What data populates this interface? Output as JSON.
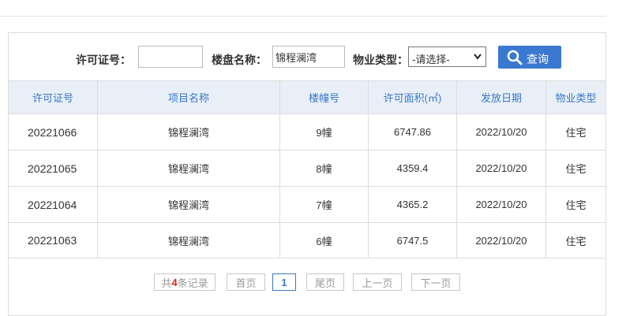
{
  "search": {
    "permit_label": "许可证号：",
    "permit_value": "",
    "project_label": "楼盘名称：",
    "project_value": "锦程澜湾",
    "type_label": "物业类型：",
    "type_selected": "-请选择-",
    "search_button": "查询"
  },
  "table": {
    "headers": [
      "许可证号",
      "项目名称",
      "楼幢号",
      "许可面积(㎡)",
      "发放日期",
      "物业类型"
    ],
    "rows": [
      [
        "20221066",
        "锦程澜湾",
        "9幢",
        "6747.86",
        "2022/10/20",
        "住宅"
      ],
      [
        "20221065",
        "锦程澜湾",
        "8幢",
        "4359.4",
        "2022/10/20",
        "住宅"
      ],
      [
        "20221064",
        "锦程澜湾",
        "7幢",
        "4365.2",
        "2022/10/20",
        "住宅"
      ],
      [
        "20221063",
        "锦程澜湾",
        "6幢",
        "6747.5",
        "2022/10/20",
        "住宅"
      ]
    ]
  },
  "pager": {
    "total_prefix": "共",
    "total_count": "4",
    "total_suffix": "条记录",
    "first": "首页",
    "current": "1",
    "last": "尾页",
    "prev": "上一页",
    "next": "下一页"
  },
  "colors": {
    "accent": "#3a78c5",
    "button": "#3b78d0",
    "header_bg": "#e9eff7",
    "count": "#e02020"
  }
}
